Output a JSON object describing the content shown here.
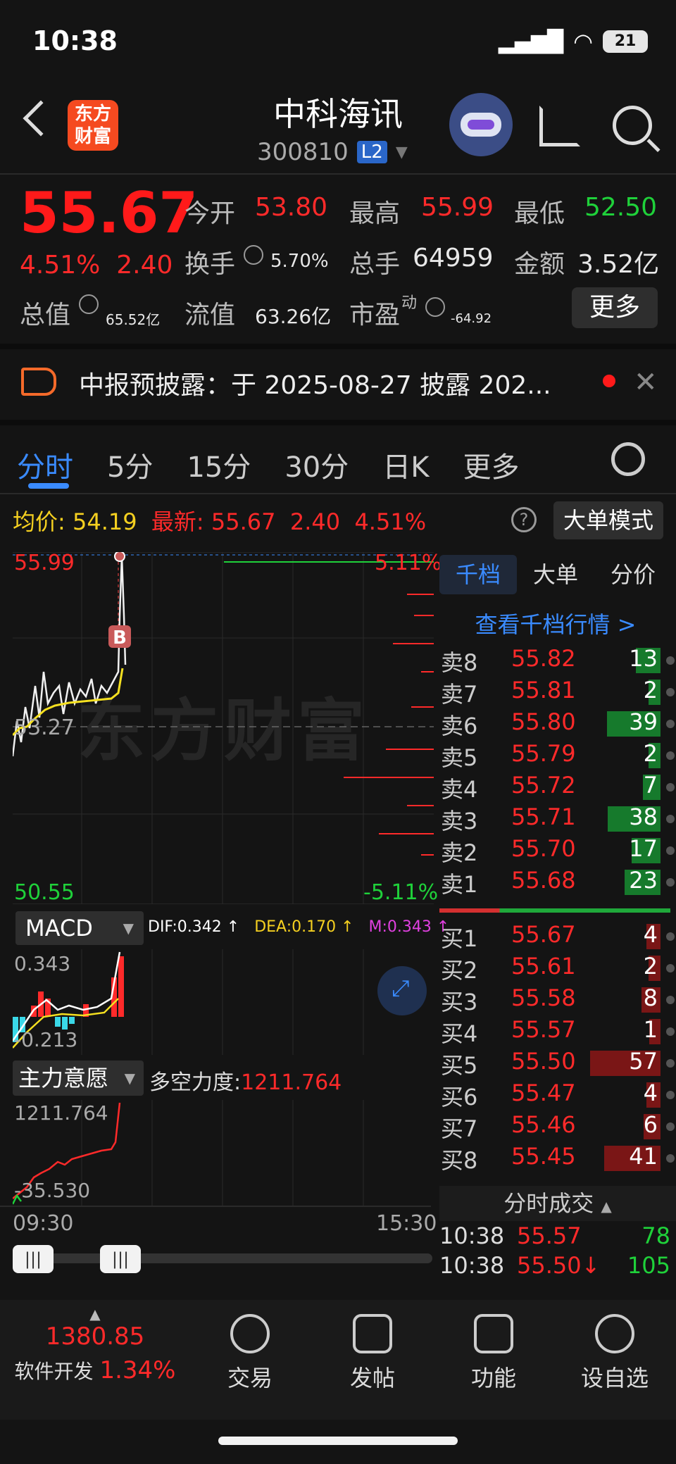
{
  "status": {
    "time": "10:38",
    "battery": "21"
  },
  "header": {
    "name": "中科海讯",
    "code": "300810",
    "level": "L2",
    "logo_text": "东方财富"
  },
  "quote": {
    "price": "55.67",
    "pct": "4.51%",
    "chg": "2.40",
    "open_label": "今开",
    "open": "53.80",
    "high_label": "最高",
    "high": "55.99",
    "low_label": "最低",
    "low": "52.50",
    "turnover_label": "换手",
    "turnover": "5.70%",
    "vol_label": "总手",
    "vol": "64959",
    "amount_label": "金额",
    "amount": "3.52亿",
    "mcap_label": "总值",
    "mcap": "65.52亿",
    "float_label": "流值",
    "float": "63.26亿",
    "pe_label": "市盈",
    "pe_sup": "动",
    "pe": "-64.92",
    "more": "更多"
  },
  "notice": {
    "text": "中报预披露：于 2025-08-27 披露 202..."
  },
  "tabs": [
    "分时",
    "5分",
    "15分",
    "30分",
    "日K",
    "更多"
  ],
  "pricebar": {
    "avg_label": "均价:",
    "avg": "54.19",
    "last_label": "最新:",
    "last": "55.67",
    "chg": "2.40",
    "pct": "4.51%",
    "mode": "大单模式"
  },
  "chart_axis": {
    "high": "55.99",
    "high_pct": "5.11%",
    "mid": "53.27",
    "low": "50.55",
    "low_pct": "-5.11%",
    "start": "09:30",
    "end": "15:30",
    "watermark": "东方财富",
    "marker": "B"
  },
  "macd": {
    "name": "MACD",
    "dif": "DIF:0.342 ↑",
    "dea": "DEA:0.170 ↑",
    "m": "M:0.343 ↑",
    "top": "0.343",
    "bottom": "-0.213"
  },
  "zl": {
    "name": "主力意愿",
    "label": "多空力度:",
    "value": "1211.764",
    "top": "1211.764",
    "bottom": "-35.530"
  },
  "orderbook": {
    "tabs": [
      "千档",
      "大单",
      "分价"
    ],
    "link": "查看千档行情 >",
    "asks": [
      {
        "label": "卖8",
        "price": "55.82",
        "vol": "13"
      },
      {
        "label": "卖7",
        "price": "55.81",
        "vol": "2"
      },
      {
        "label": "卖6",
        "price": "55.80",
        "vol": "39"
      },
      {
        "label": "卖5",
        "price": "55.79",
        "vol": "2"
      },
      {
        "label": "卖4",
        "price": "55.72",
        "vol": "7"
      },
      {
        "label": "卖3",
        "price": "55.71",
        "vol": "38"
      },
      {
        "label": "卖2",
        "price": "55.70",
        "vol": "17"
      },
      {
        "label": "卖1",
        "price": "55.68",
        "vol": "23"
      }
    ],
    "bids": [
      {
        "label": "买1",
        "price": "55.67",
        "vol": "4"
      },
      {
        "label": "买2",
        "price": "55.61",
        "vol": "2"
      },
      {
        "label": "买3",
        "price": "55.58",
        "vol": "8"
      },
      {
        "label": "买4",
        "price": "55.57",
        "vol": "1"
      },
      {
        "label": "买5",
        "price": "55.50",
        "vol": "57"
      },
      {
        "label": "买6",
        "price": "55.47",
        "vol": "4"
      },
      {
        "label": "买7",
        "price": "55.46",
        "vol": "6"
      },
      {
        "label": "买8",
        "price": "55.45",
        "vol": "41"
      }
    ]
  },
  "ticks": {
    "title": "分时成交",
    "rows": [
      {
        "time": "10:38",
        "price": "55.57",
        "vol": "78"
      },
      {
        "time": "10:38",
        "price": "55.50↓",
        "vol": "105"
      }
    ]
  },
  "nav": {
    "index_value": "1380.85",
    "index_name": "软件开发",
    "index_pct": "1.34%",
    "items": [
      "交易",
      "发帖",
      "功能",
      "设自选"
    ]
  }
}
